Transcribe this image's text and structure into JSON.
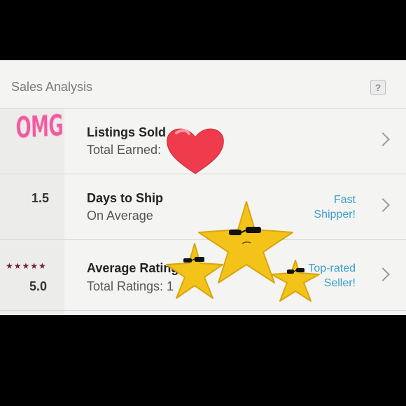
{
  "header": {
    "title": "Sales Analysis",
    "help_label": "?"
  },
  "rows": [
    {
      "title": "Listings Sold",
      "subtitle": "Total Earned:",
      "left_value": "",
      "badge": ""
    },
    {
      "title": "Days to Ship",
      "subtitle": "On Average",
      "left_value": "1.5",
      "badge_line1": "Fast",
      "badge_line2": "Shipper!"
    },
    {
      "title": "Average Rating",
      "subtitle": "Total Ratings: 1",
      "left_value": "5.0",
      "stars": "★★★★★",
      "badge_line1": "Top-rated",
      "badge_line2": "Seller!"
    }
  ],
  "stickers": {
    "omg_text": "OMG"
  },
  "colors": {
    "accent": "#3a9ecb",
    "heart": "#ef3b4c",
    "star": "#f3c31a",
    "star_dark": "#7a1e2e",
    "omg": "#f05aa0"
  },
  "icons": [
    "help-icon",
    "chevron-right-icon",
    "heart-sticker-icon",
    "cool-star-sticker-icon"
  ]
}
